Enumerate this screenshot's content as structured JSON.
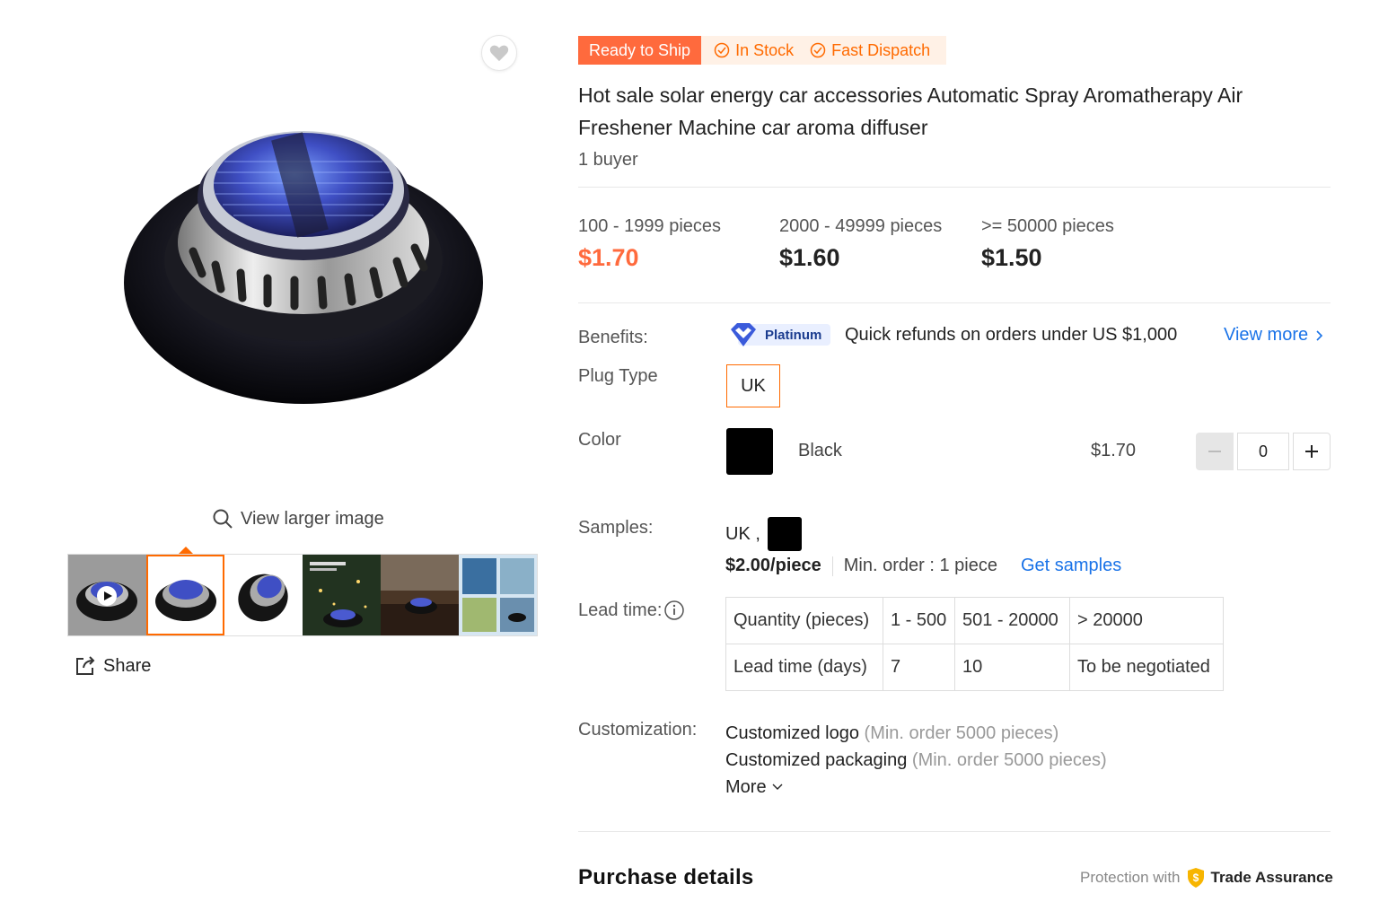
{
  "gallery": {
    "favorite_icon": "heart-icon",
    "view_larger_label": "View larger image",
    "share_label": "Share",
    "thumbnails": [
      "video",
      "front",
      "angle",
      "night-scene",
      "dashboard-scene",
      "info-collage"
    ],
    "active_thumbnail_index": 1
  },
  "badges": {
    "ready_to_ship": "Ready to Ship",
    "in_stock": "In Stock",
    "fast_dispatch": "Fast Dispatch"
  },
  "product": {
    "title": "Hot sale solar energy car accessories Automatic Spray Aromatherapy Air Freshener Machine car aroma diffuser",
    "buyers": "1 buyer"
  },
  "price_tiers": [
    {
      "range": "100 - 1999 pieces",
      "price": "$1.70"
    },
    {
      "range": "2000 - 49999 pieces",
      "price": "$1.60"
    },
    {
      "range": ">= 50000 pieces",
      "price": "$1.50"
    }
  ],
  "benefits": {
    "label": "Benefits:",
    "badge": "Platinum",
    "text": "Quick refunds on orders under US $1,000",
    "view_more": "View more"
  },
  "plug_type": {
    "label": "Plug Type",
    "option": "UK"
  },
  "color": {
    "label": "Color",
    "name": "Black",
    "price": "$1.70",
    "quantity": "0",
    "swatch_color": "#000000"
  },
  "samples": {
    "label": "Samples:",
    "value": "UK ,",
    "price": "$2.00/piece",
    "min_order": "Min. order : 1 piece",
    "get_samples": "Get samples"
  },
  "lead_time": {
    "label": "Lead time:",
    "rows": [
      [
        "Quantity (pieces)",
        "1 - 500",
        "501 - 20000",
        "> 20000"
      ],
      [
        "Lead time (days)",
        "7",
        "10",
        "To be negotiated"
      ]
    ]
  },
  "customization": {
    "label": "Customization:",
    "items": [
      {
        "name": "Customized logo",
        "note": "(Min. order 5000 pieces)"
      },
      {
        "name": "Customized packaging",
        "note": "(Min. order 5000 pieces)"
      }
    ],
    "more": "More"
  },
  "footer": {
    "purchase_details": "Purchase details",
    "protection_with": "Protection with",
    "trade_assurance": "Trade Assurance"
  },
  "colors": {
    "accent": "#ff6a00",
    "badge_orange": "#ff6a3d",
    "link": "#1a73e8"
  }
}
